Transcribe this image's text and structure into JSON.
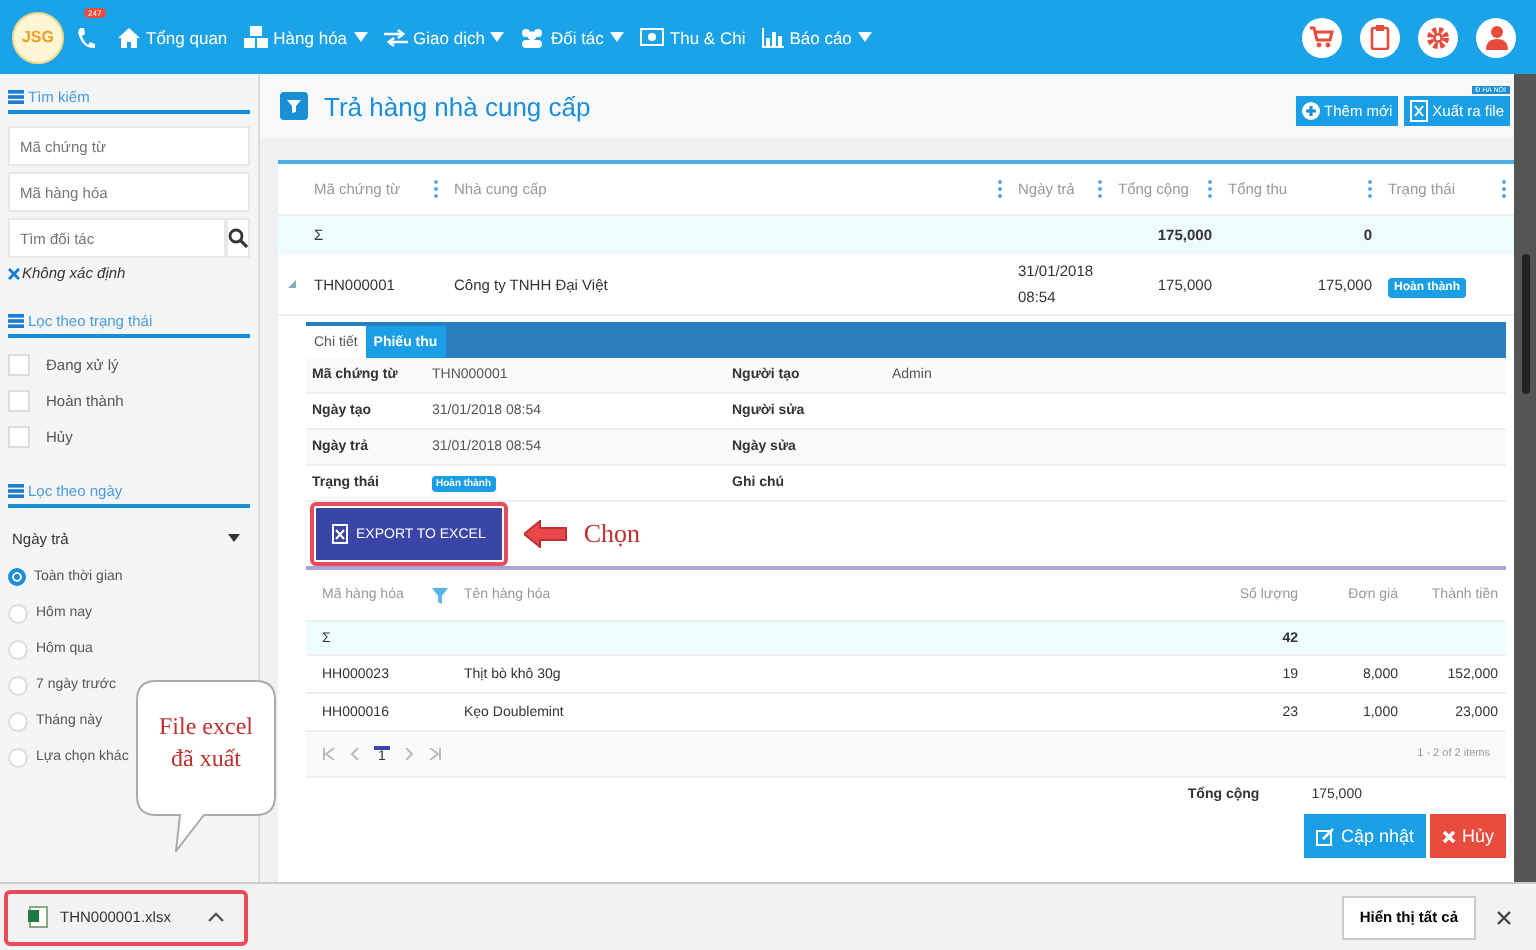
{
  "nav": {
    "logo": "JSG",
    "hotline_badge": "247",
    "items": [
      {
        "label": "Tổng quan",
        "kind": "home",
        "caret": false
      },
      {
        "label": "Hàng hóa",
        "kind": "goods",
        "caret": true
      },
      {
        "label": "Giao dịch",
        "kind": "swap",
        "caret": true
      },
      {
        "label": "Đối tác",
        "kind": "people",
        "caret": true
      },
      {
        "label": "Thu & Chi",
        "kind": "money",
        "caret": false
      },
      {
        "label": "Báo cáo",
        "kind": "chart",
        "caret": true
      }
    ],
    "branch": "Đ HA NOI"
  },
  "sidebar": {
    "search": {
      "title": "Tìm kiếm",
      "fields": [
        {
          "placeholder": "Mã chứng từ"
        },
        {
          "placeholder": "Mã hàng hóa"
        }
      ],
      "partner_placeholder": "Tìm đối tác",
      "chip": "Không xác định"
    },
    "status_filter": {
      "title": "Lọc theo trạng thái",
      "options": [
        {
          "label": "Đang xử lý",
          "checked": false
        },
        {
          "label": "Hoàn thành",
          "checked": false
        },
        {
          "label": "Hủy",
          "checked": false
        }
      ]
    },
    "date_filter": {
      "title": "Lọc theo ngày",
      "select": "Ngày trả",
      "options": [
        {
          "label": "Toàn thời gian",
          "selected": true
        },
        {
          "label": "Hôm nay",
          "selected": false
        },
        {
          "label": "Hôm qua",
          "selected": false
        },
        {
          "label": "7 ngày trước",
          "selected": false
        },
        {
          "label": "Tháng này",
          "selected": false
        },
        {
          "label": "Lựa chọn khác",
          "selected": false
        }
      ]
    }
  },
  "page": {
    "title": "Trả hàng nhà cung cấp",
    "buttons": [
      {
        "label": "Thêm mới",
        "kind": "add"
      },
      {
        "label": "Xuất ra file",
        "kind": "excel"
      }
    ]
  },
  "table": {
    "columns": [
      "Mã chứng từ",
      "Nhà cung cấp",
      "Ngày trả",
      "Tổng cộng",
      "Tổng thu",
      "Trạng thái"
    ],
    "sum_row": {
      "symbol": "Σ",
      "total": "175,000",
      "paid": "0"
    },
    "rows": [
      {
        "code": "THN000001",
        "supplier": "Công ty TNHH Đại Việt",
        "date": "31/01/2018",
        "time": "08:54",
        "total": "175,000",
        "paid": "175,000",
        "status": "Hoàn thành",
        "expanded": true
      }
    ]
  },
  "detail": {
    "tabs": [
      {
        "label": "Chi tiết",
        "selected": true
      },
      {
        "label": "Phiếu thu",
        "selected": false
      }
    ],
    "info": [
      {
        "label": "Mã chứng từ",
        "value": "THN000001",
        "label_2": "Người tạo",
        "value_2": "Admin"
      },
      {
        "label": "Ngày tạo",
        "value": "31/01/2018 08:54",
        "label_2": "Người sửa"
      },
      {
        "label": "Ngày trả",
        "value": "31/01/2018 08:54",
        "label_2": "Ngày sửa"
      },
      {
        "label": "Trạng thái",
        "badge": "Hoàn thành",
        "label_2": "Ghi chú"
      }
    ],
    "export_button": "EXPORT TO EXCEL",
    "callout": "Chọn",
    "products": {
      "columns": [
        "Mã hàng hóa",
        "Tên hàng hóa",
        "Số lượng",
        "Đơn giá",
        "Thành tiền"
      ],
      "sum_row": {
        "symbol": "Σ",
        "quantity": "42"
      },
      "rows": [
        {
          "code": "HH000023",
          "name": "Thịt bò khô 30g",
          "quantity": "19",
          "price": "8,000",
          "amount": "152,000"
        },
        {
          "code": "HH000016",
          "name": "Kẹo Doublemint",
          "quantity": "23",
          "price": "1,000",
          "amount": "23,000"
        }
      ],
      "pages": [
        {
          "label": "1",
          "selected": true
        }
      ],
      "range": "1 - 2 of 2 items"
    },
    "total_label": "Tổng cộng",
    "total_value": "175,000",
    "buttons": [
      {
        "label": "Cập nhật",
        "kind": "update"
      },
      {
        "label": "Hủy",
        "kind": "cancel"
      }
    ]
  },
  "bubble": {
    "lines": [
      "File excel",
      "đã xuất"
    ]
  },
  "downloads": {
    "file": "THN000001.xlsx",
    "show_all": "Hiển thị tất cả"
  }
}
